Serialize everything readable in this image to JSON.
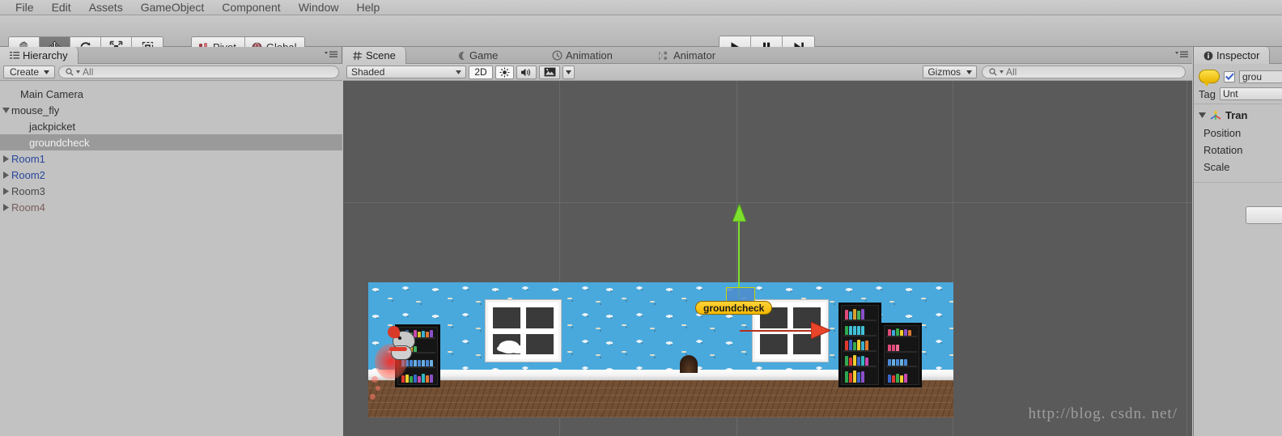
{
  "menubar": {
    "items": [
      {
        "label": "File"
      },
      {
        "label": "Edit"
      },
      {
        "label": "Assets"
      },
      {
        "label": "GameObject"
      },
      {
        "label": "Component"
      },
      {
        "label": "Window"
      },
      {
        "label": "Help"
      }
    ]
  },
  "toolbar": {
    "transform_tools": [
      {
        "name": "hand-tool",
        "active": false
      },
      {
        "name": "move-tool",
        "active": true
      },
      {
        "name": "rotate-tool",
        "active": false
      },
      {
        "name": "scale-tool",
        "active": false
      },
      {
        "name": "rect-tool",
        "active": false
      }
    ],
    "pivot_label": "Pivot",
    "global_label": "Global",
    "play_label": "Play",
    "pause_label": "Pause",
    "step_label": "Step"
  },
  "hierarchy": {
    "tab_label": "Hierarchy",
    "create_label": "Create",
    "search_value": "All",
    "search_placeholder": "All",
    "items": [
      {
        "label": "Main Camera",
        "depth": 1,
        "expandable": false,
        "expanded": false,
        "selected": false,
        "color": "#2f2f2f"
      },
      {
        "label": "mouse_fly",
        "depth": 0,
        "expandable": true,
        "expanded": true,
        "selected": false,
        "color": "#2f2f2f"
      },
      {
        "label": "jackpicket",
        "depth": 2,
        "expandable": false,
        "expanded": false,
        "selected": false,
        "color": "#2f2f2f"
      },
      {
        "label": "groundcheck",
        "depth": 2,
        "expandable": false,
        "expanded": false,
        "selected": true,
        "color": "#f2f2f2"
      },
      {
        "label": "Room1",
        "depth": 0,
        "expandable": true,
        "expanded": false,
        "selected": false,
        "color": "#29489c"
      },
      {
        "label": "Room2",
        "depth": 0,
        "expandable": true,
        "expanded": false,
        "selected": false,
        "color": "#29489c"
      },
      {
        "label": "Room3",
        "depth": 0,
        "expandable": true,
        "expanded": false,
        "selected": false,
        "color": "#4a4a4a"
      },
      {
        "label": "Room4",
        "depth": 0,
        "expandable": true,
        "expanded": false,
        "selected": false,
        "color": "#7a5c5c"
      }
    ]
  },
  "scene_panel": {
    "tabs": [
      {
        "label": "Scene",
        "icon": "hash-icon",
        "selected": true
      },
      {
        "label": "Game",
        "icon": "gamepad-icon",
        "selected": false
      },
      {
        "label": "Animation",
        "icon": "clock-icon",
        "selected": false
      },
      {
        "label": "Animator",
        "icon": "animator-icon",
        "selected": false
      }
    ],
    "shading_mode": "Shaded",
    "mode_2d_label": "2D",
    "lighting_toggle": "sun-icon",
    "audio_toggle": "speaker-icon",
    "effects_toggle": "image-icon",
    "gizmos_label": "Gizmos",
    "search_value": "All",
    "search_placeholder": "All"
  },
  "scene": {
    "selected_object_label": "groundcheck",
    "gizmo": {
      "y_axis_color": "#7ee02e",
      "x_axis_color": "#e8452a",
      "handle_color": "#4e8ccd"
    },
    "colors": {
      "wall": "#4aa9dc",
      "floor": "#7a5436",
      "baseboard": "#ffffff",
      "shelf": "#151515",
      "viewport_bg": "#5a5a5a"
    }
  },
  "inspector": {
    "tab_label": "Inspector",
    "object_name": "grou",
    "enabled": true,
    "tag_label": "Tag",
    "tag_value": "Unt",
    "component_title": "Tran",
    "properties": [
      {
        "label": "Position"
      },
      {
        "label": "Rotation"
      },
      {
        "label": "Scale"
      }
    ]
  },
  "watermark": {
    "text": "http://blog. csdn. net/"
  }
}
